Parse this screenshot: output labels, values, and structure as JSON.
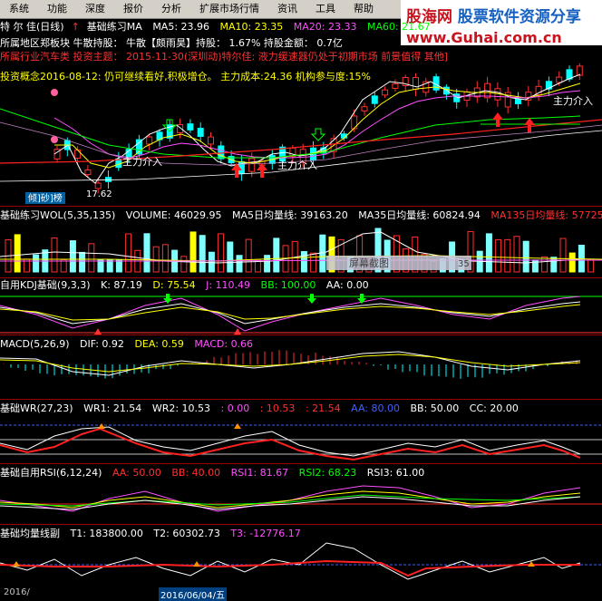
{
  "menu": [
    "系统",
    "功能",
    "深度",
    "报价",
    "分析",
    "扩展市场行情",
    "资讯",
    "工具",
    "帮助"
  ],
  "logo": {
    "cn_a": "股海网",
    "cn_b": "股票软件资源分享",
    "url": "www.Guhai.com.cn"
  },
  "main": {
    "stock": "特 尔 佳(日线)",
    "indicator": "基础练习MA",
    "ma5": "MA5: 23.96",
    "ma10": "MA10: 23.35",
    "ma20": "MA20: 23.33",
    "ma60": "MA60: 21.67",
    "line2": "所属地区郑板块  牛散持股： 牛散【颇雨昊】持股： 1.67% 持股金额： 0.7亿",
    "line3": "所属行业汽车类  投资主题： 2015-11-30(深圳动)特尔佳: 液力缓速器仍处于初期市场 前景值得 其他]",
    "line4": "投资概念2016-08-12: 仍可继续看好,积极增仓。   主力成本:24.36  机构参与度:15%",
    "label_main_in": "主力介入",
    "low_price": "17.62",
    "tag": "倾]砂]榜"
  },
  "volume": {
    "title": "基础练习WOL(5,35,135)",
    "v": "VOLUME: 46029.95",
    "ma5": "MA5日均量线: 39163.20",
    "ma35": "MA35日均量线: 60824.94",
    "ma135": "MA135日均量线: 57725.02",
    "screenshot_label": "屏幕截图",
    "num_label": "35"
  },
  "kdj": {
    "title": "自用KDJ基础(9,3,3)",
    "k": "K: 87.19",
    "d": "D: 75.54",
    "j": "J: 110.49",
    "bb": "BB: 100.00",
    "aa": "AA: 0.00"
  },
  "macd": {
    "title": "MACD(5,26,9)",
    "dif": "DIF: 0.92",
    "dea": "DEA: 0.59",
    "macd": "MACD: 0.66"
  },
  "wr": {
    "title": "基础WR(27,23)",
    "wr1": "WR1: 21.54",
    "wr2": "WR2: 10.53",
    "v1": ": 0.00",
    "v2": ": 10.53",
    "v3": ": 21.54",
    "aa": "AA: 80.00",
    "bb": "BB: 50.00",
    "cc": "CC: 20.00"
  },
  "rsi": {
    "title": "基础自用RSI(6,12,24)",
    "aa": "AA: 50.00",
    "bb": "BB: 40.00",
    "rsi1": "RSI1: 81.67",
    "rsi2": "RSI2: 68.23",
    "rsi3": "RSI3: 61.00"
  },
  "avg": {
    "title": "基础均量线副",
    "t1": "T1: 183800.00",
    "t2": "T2: 60302.73",
    "t3": "T3: -12776.17"
  },
  "footer": {
    "year": "2016/",
    "date": "2016/06/04/五"
  },
  "colors": {
    "up": "#ff3030",
    "down": "#00ffff",
    "grid": "#990000"
  }
}
